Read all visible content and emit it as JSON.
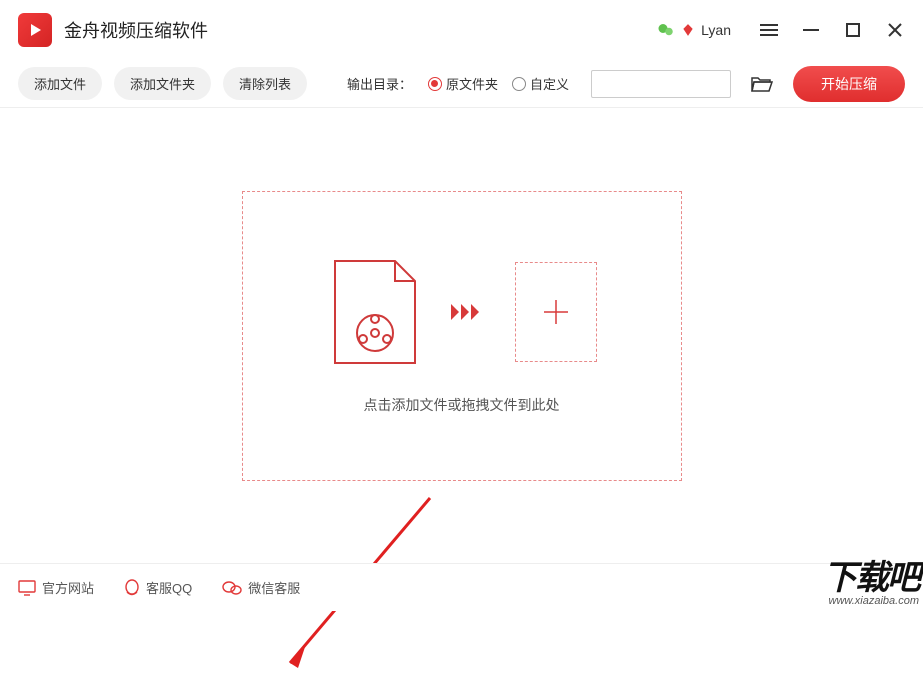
{
  "header": {
    "app_title": "金舟视频压缩软件",
    "user_name": "Lyan"
  },
  "toolbar": {
    "add_file": "添加文件",
    "add_folder": "添加文件夹",
    "clear_list": "清除列表",
    "output_label": "输出目录：",
    "radio_source": "原文件夹",
    "radio_custom": "自定义",
    "path_value": "",
    "start_label": "开始压缩"
  },
  "dropzone": {
    "hint": "点击添加文件或拖拽文件到此处"
  },
  "footer": {
    "website": "官方网站",
    "qq": "客服QQ",
    "wechat": "微信客服"
  },
  "watermark": {
    "big": "下载吧",
    "url": "www.xiazaiba.com"
  }
}
